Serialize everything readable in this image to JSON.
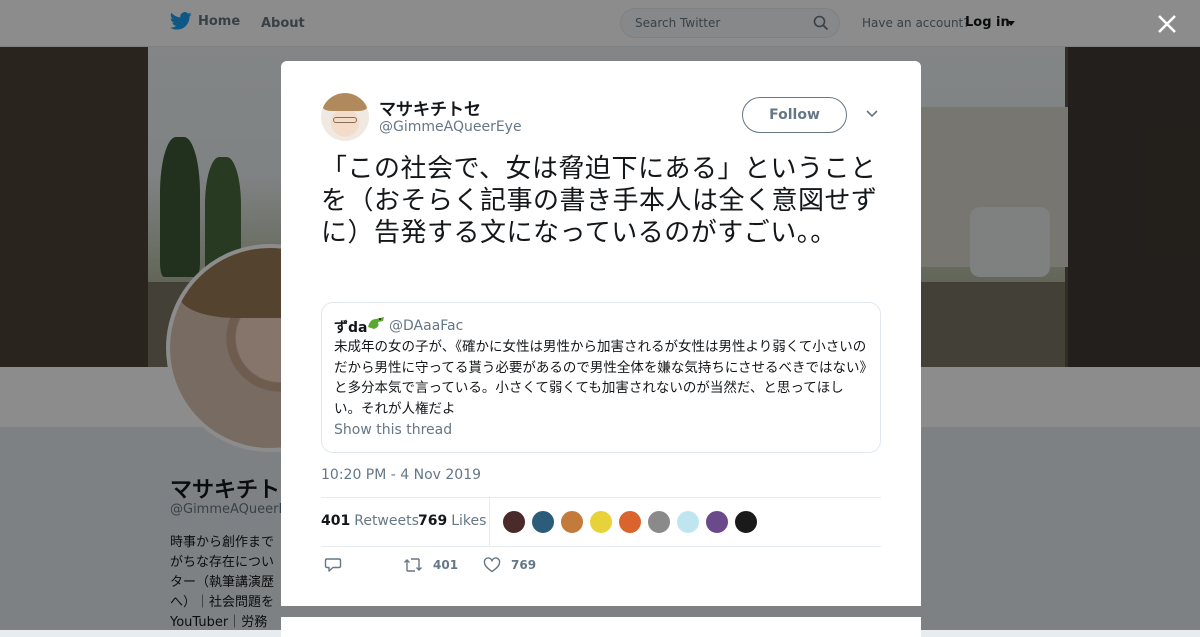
{
  "nav": {
    "home_label": "Home",
    "about_label": "About",
    "search_placeholder": "Search Twitter",
    "account_prompt": "Have an account?",
    "login_label": "Log in"
  },
  "profile": {
    "name": "マサキチトセ",
    "handle": "@GimmeAQueerEye",
    "bio": "時事から創作まで\nがちな存在につい\nター（執筆講演歴\nへ）｜社会問題を\nYouTuber｜労務"
  },
  "tweet": {
    "author_name": "マサキチトセ",
    "author_handle": "@GimmeAQueerEye",
    "follow_label": "Follow",
    "text": "「この社会で、女は脅迫下にある」ということを（おそらく記事の書き手本人は全く意図せずに）告発する文になっているのがすごい。。",
    "timestamp": "10:20 PM - 4 Nov 2019",
    "retweets_count": "401",
    "retweets_label": "Retweets",
    "likes_count": "769",
    "likes_label": "Likes",
    "action_retweet_count": "401",
    "action_like_count": "769"
  },
  "quoted": {
    "name": "ずda",
    "handle": "@DAaaFac",
    "text": "未成年の女の子が、《確かに女性は男性から加害されるが女性は男性より弱くて小さいのだから男性に守ってる貰う必要があるので男性全体を嫌な気持ちにさせるべきではない》と多分本気で言っている。小さくて弱くても加害されないのが当然だ、と思ってほしい。それが人権だよ",
    "show_thread_label": "Show this thread"
  },
  "liker_avatar_colors": [
    "#4a2a2a",
    "#2b5d7a",
    "#c47a3a",
    "#e8d23a",
    "#d9642e",
    "#8a8a8a",
    "#bfe6f0",
    "#6a4a8a",
    "#1a1a1a"
  ],
  "colors": {
    "twitter_blue": "#1da1f2",
    "secondary_text": "#657786"
  }
}
